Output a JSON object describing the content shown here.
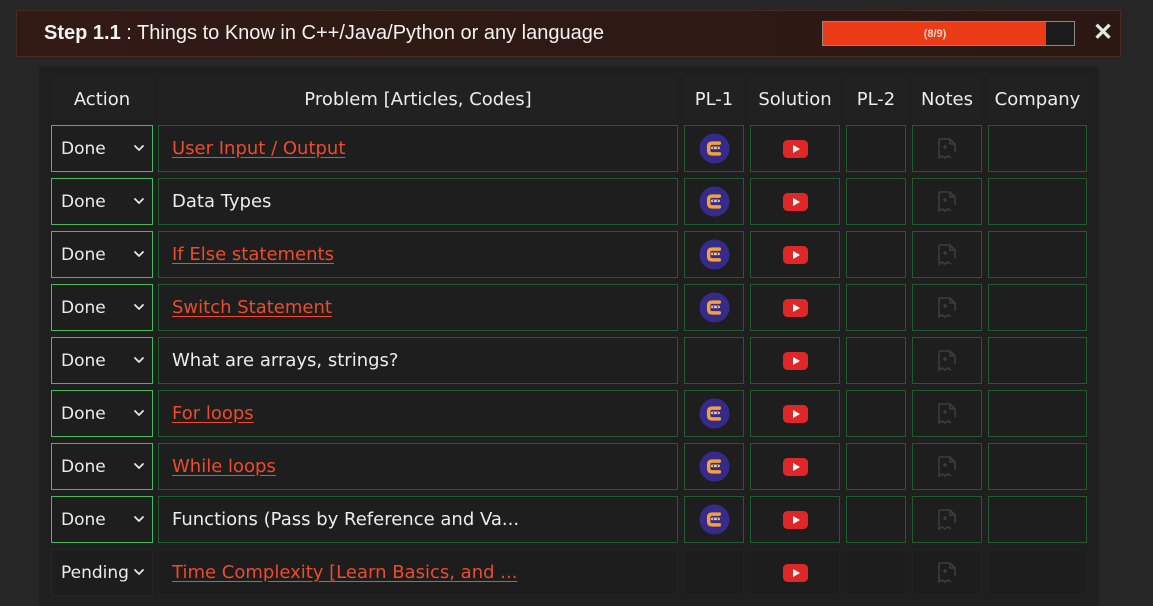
{
  "header": {
    "step_label": "Step 1.1",
    "step_title": " : Things to Know in C++/Java/Python or any language",
    "progress_text": "(8/9)",
    "progress_fraction": 0.889,
    "close_label": "✕"
  },
  "colors": {
    "accent": "#ec3b17",
    "link": "#ee4b2b",
    "done_border": "#3fbd5a",
    "youtube": "#e02727",
    "codingninjas": "#352b8a"
  },
  "table": {
    "headers": {
      "action": "Action",
      "problem": "Problem [Articles, Codes]",
      "pl1": "PL-1",
      "solution": "Solution",
      "pl2": "PL-2",
      "notes": "Notes",
      "company": "Company"
    },
    "icons": {
      "pl1": "codingninjas-icon",
      "solution": "youtube-icon",
      "notes": "note-add-icon"
    },
    "rows": [
      {
        "status": "Done",
        "problem": "User Input / Output",
        "is_link": true,
        "has_pl1": true,
        "has_solution": true
      },
      {
        "status": "Done",
        "problem": "Data Types",
        "is_link": false,
        "has_pl1": true,
        "has_solution": true
      },
      {
        "status": "Done",
        "problem": "If Else statements",
        "is_link": true,
        "has_pl1": true,
        "has_solution": true
      },
      {
        "status": "Done",
        "problem": "Switch Statement",
        "is_link": true,
        "has_pl1": true,
        "has_solution": true
      },
      {
        "status": "Done",
        "problem": "What are arrays, strings?",
        "is_link": false,
        "has_pl1": false,
        "has_solution": true
      },
      {
        "status": "Done",
        "problem": "For loops",
        "is_link": true,
        "has_pl1": true,
        "has_solution": true
      },
      {
        "status": "Done",
        "problem": "While loops",
        "is_link": true,
        "has_pl1": true,
        "has_solution": true
      },
      {
        "status": "Done",
        "problem": "Functions (Pass by Reference and Va...",
        "is_link": false,
        "has_pl1": true,
        "has_solution": true
      },
      {
        "status": "Pending",
        "problem": "Time Complexity [Learn Basics, and ...",
        "is_link": true,
        "has_pl1": false,
        "has_solution": true
      }
    ]
  }
}
